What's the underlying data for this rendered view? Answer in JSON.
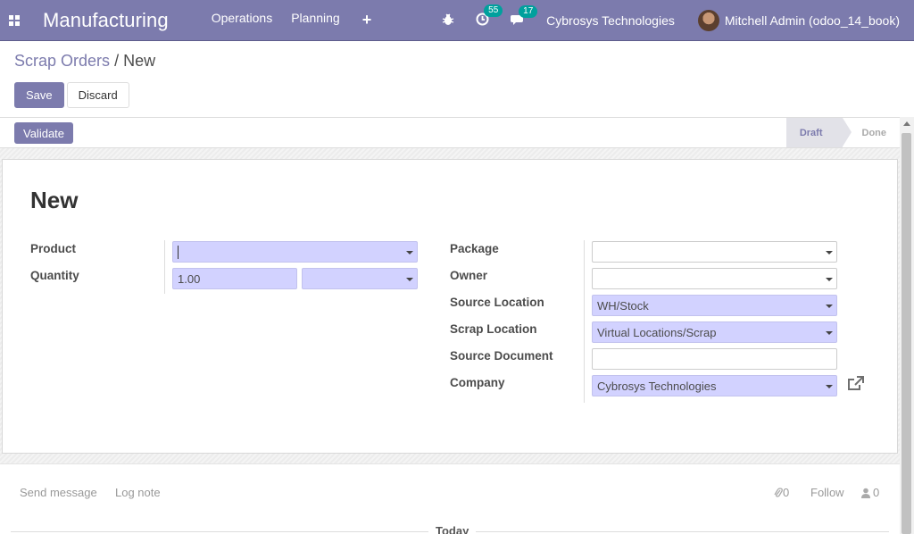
{
  "navbar": {
    "apps_icon": "apps-grid-icon",
    "brand": "Manufacturing",
    "menu": [
      "Operations",
      "Planning"
    ],
    "plus_icon": "+",
    "bug_icon": "bug-icon",
    "activity_count": "55",
    "messages_count": "17",
    "company": "Cybrosys Technologies",
    "user": "Mitchell Admin (odoo_14_book)"
  },
  "breadcrumb": {
    "parent": "Scrap Orders",
    "separator": "/",
    "current": "New"
  },
  "buttons": {
    "save": "Save",
    "discard": "Discard"
  },
  "statusbar": {
    "validate": "Validate",
    "stages": [
      "Draft",
      "Done"
    ],
    "active_stage": "Draft"
  },
  "form": {
    "title": "New",
    "product": {
      "label": "Product",
      "value": ""
    },
    "quantity": {
      "label": "Quantity",
      "value": "1.00",
      "uom": ""
    },
    "package": {
      "label": "Package",
      "value": ""
    },
    "owner": {
      "label": "Owner",
      "value": ""
    },
    "source_location": {
      "label": "Source Location",
      "value": "WH/Stock"
    },
    "scrap_location": {
      "label": "Scrap Location",
      "value": "Virtual Locations/Scrap"
    },
    "source_document": {
      "label": "Source Document",
      "value": ""
    },
    "company": {
      "label": "Company",
      "value": "Cybrosys Technologies"
    }
  },
  "chatter": {
    "send_message": "Send message",
    "log_note": "Log note",
    "attachments": "0",
    "follow": "Follow",
    "followers": "0",
    "today": "Today"
  },
  "colors": {
    "primary": "#7c7bad",
    "required_field": "#d2d2ff",
    "badge": "#00a09d"
  }
}
